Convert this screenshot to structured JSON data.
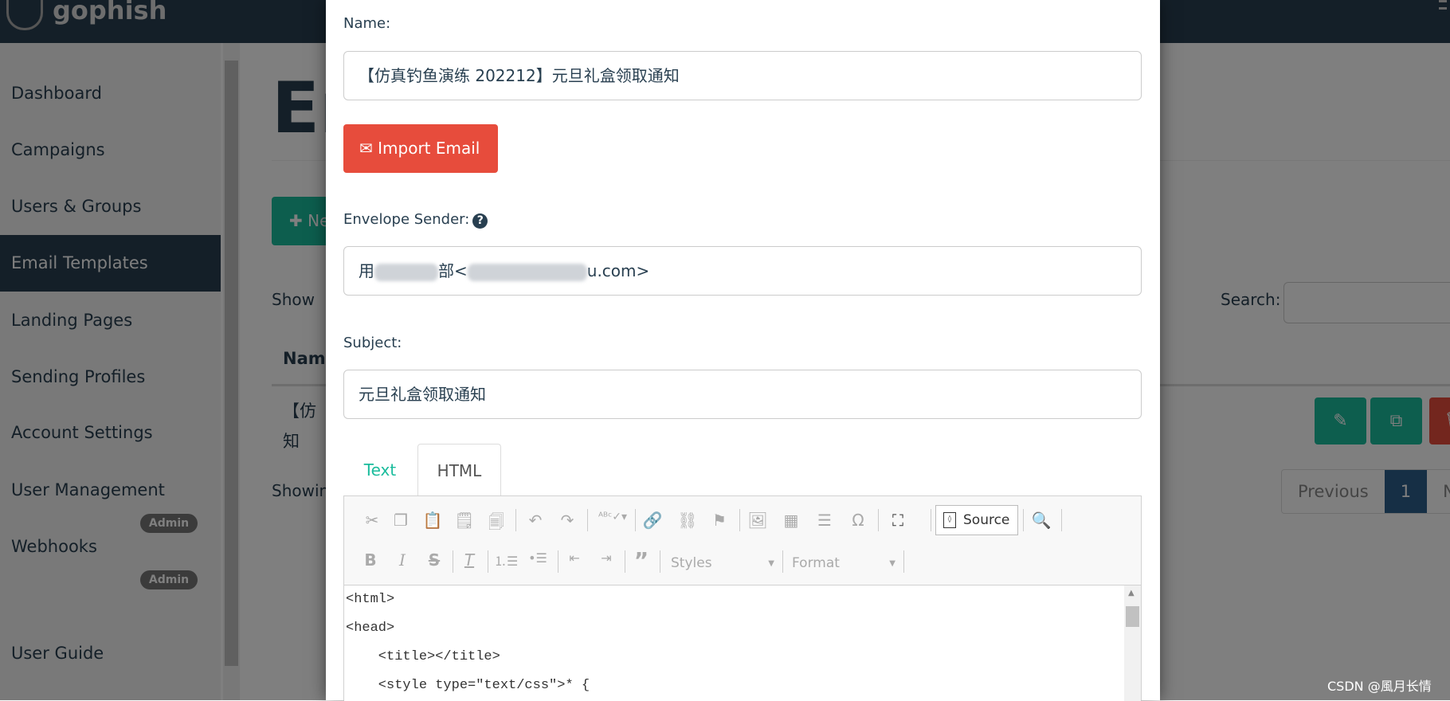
{
  "app": {
    "brand": "gophish"
  },
  "sidebar": {
    "items": [
      {
        "label": "Dashboard"
      },
      {
        "label": "Campaigns"
      },
      {
        "label": "Users & Groups"
      },
      {
        "label": "Email Templates",
        "active": true
      },
      {
        "label": "Landing Pages"
      },
      {
        "label": "Sending Profiles"
      },
      {
        "label": "Account Settings"
      },
      {
        "label": "User Management"
      },
      {
        "label": "Webhooks"
      },
      {
        "label": "User Guide"
      }
    ],
    "badges": [
      "Admin",
      "Admin"
    ]
  },
  "page": {
    "title": "Em",
    "new_button": "Ne",
    "show_label": "Show",
    "search_label": "Search:",
    "search_value": "",
    "table_header": "Name",
    "row_name_visible": "【仿",
    "row_name_line2": "知",
    "showing": "Showin",
    "pagination": {
      "previous": "Previous",
      "current": "1",
      "next": "Ne"
    }
  },
  "modal": {
    "name_label": "Name:",
    "name_value": "【仿真钓鱼演练 202212】元旦礼盒领取通知",
    "import_button": "Import Email",
    "envelope_label": "Envelope Sender:",
    "envelope_parts": {
      "start": "用",
      "middle": "部<",
      "end": "u.com>"
    },
    "subject_label": "Subject:",
    "subject_value": "元旦礼盒领取通知",
    "tabs": [
      {
        "label": "Text"
      },
      {
        "label": "HTML",
        "active": true
      }
    ],
    "editor": {
      "source_button": "Source",
      "styles_combo": "Styles",
      "format_combo": "Format",
      "code_lines": [
        "<html>",
        "<head>",
        "    <title></title>",
        "    <style type=\"text/css\">* {"
      ]
    }
  },
  "watermark": "CSDN @風月长情",
  "colors": {
    "navbar": "#283f50",
    "primary": "#1abc9c",
    "danger": "#e74c3c",
    "pager_active": "#2c5f8a"
  }
}
